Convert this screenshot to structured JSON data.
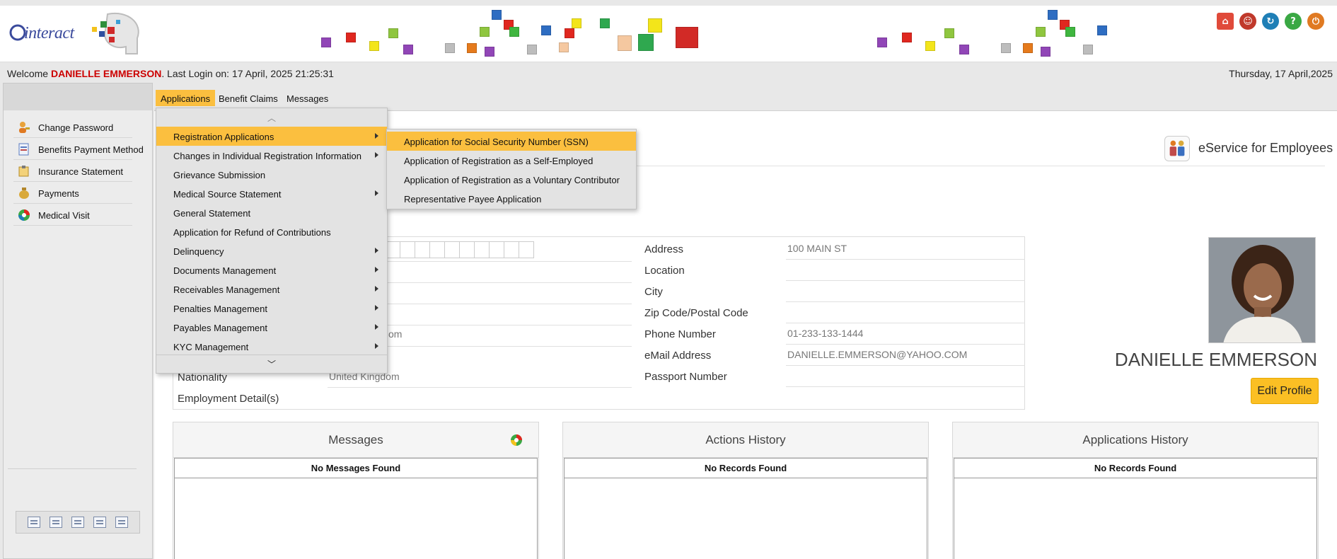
{
  "brand": {
    "logo_text": "interact"
  },
  "header_icons": [
    "home-icon",
    "user-icon",
    "refresh-icon",
    "help-icon",
    "logout-icon"
  ],
  "welcome": {
    "prefix": "Welcome ",
    "user": "DANIELLE EMMERSON",
    "last_login": ". Last Login on: 17 April, 2025 21:25:31",
    "date": "Thursday, 17 April,2025"
  },
  "sidebar": {
    "items": [
      {
        "label": "Change Password",
        "icon": "key-user-icon"
      },
      {
        "label": "Benefits Payment Method",
        "icon": "document-icon"
      },
      {
        "label": "Insurance Statement",
        "icon": "statement-icon"
      },
      {
        "label": "Payments",
        "icon": "money-bag-icon"
      },
      {
        "label": "Medical Visit",
        "icon": "medical-icon"
      }
    ]
  },
  "menubar": {
    "tabs": [
      "Applications",
      "Benefit Claims",
      "Messages"
    ]
  },
  "dropdown": {
    "items": [
      {
        "label": "Registration Applications",
        "has_sub": true
      },
      {
        "label": "Changes in Individual Registration Information",
        "has_sub": true
      },
      {
        "label": "Grievance Submission",
        "has_sub": false
      },
      {
        "label": "Medical Source Statement",
        "has_sub": true
      },
      {
        "label": "General Statement",
        "has_sub": false
      },
      {
        "label": "Application for Refund of Contributions",
        "has_sub": false
      },
      {
        "label": "Delinquency",
        "has_sub": true
      },
      {
        "label": "Documents Management",
        "has_sub": true
      },
      {
        "label": "Receivables Management",
        "has_sub": true
      },
      {
        "label": "Penalties Management",
        "has_sub": true
      },
      {
        "label": "Payables Management",
        "has_sub": true
      },
      {
        "label": "KYC Management",
        "has_sub": true
      }
    ]
  },
  "submenu": {
    "items": [
      "Application for Social Security Number (SSN)",
      "Application of Registration as a Self-Employed",
      "Application of Registration as a Voluntary Contributor",
      "Representative Payee Application"
    ]
  },
  "service": {
    "title": "eService for Employees"
  },
  "profile": {
    "left_visible": {
      "email_suffix": "om",
      "nationality_label": "Nationality",
      "nationality_value": "United Kingdom",
      "employment_label": "Employment Detail(s)"
    },
    "fields": [
      {
        "label": "Address",
        "value": "100 MAIN ST"
      },
      {
        "label": "Location",
        "value": ""
      },
      {
        "label": "City",
        "value": ""
      },
      {
        "label": "Zip Code/Postal Code",
        "value": ""
      },
      {
        "label": "Phone Number",
        "value": "01-233-133-1444"
      },
      {
        "label": "eMail Address",
        "value": "DANIELLE.EMMERSON@YAHOO.COM"
      },
      {
        "label": "Passport Number",
        "value": ""
      }
    ],
    "name": "DANIELLE EMMERSON",
    "edit_label": "Edit Profile"
  },
  "widgets": [
    {
      "title": "Messages",
      "empty": "No Messages Found"
    },
    {
      "title": "Actions History",
      "empty": "No Records Found"
    },
    {
      "title": "Applications History",
      "empty": "No Records Found"
    }
  ]
}
